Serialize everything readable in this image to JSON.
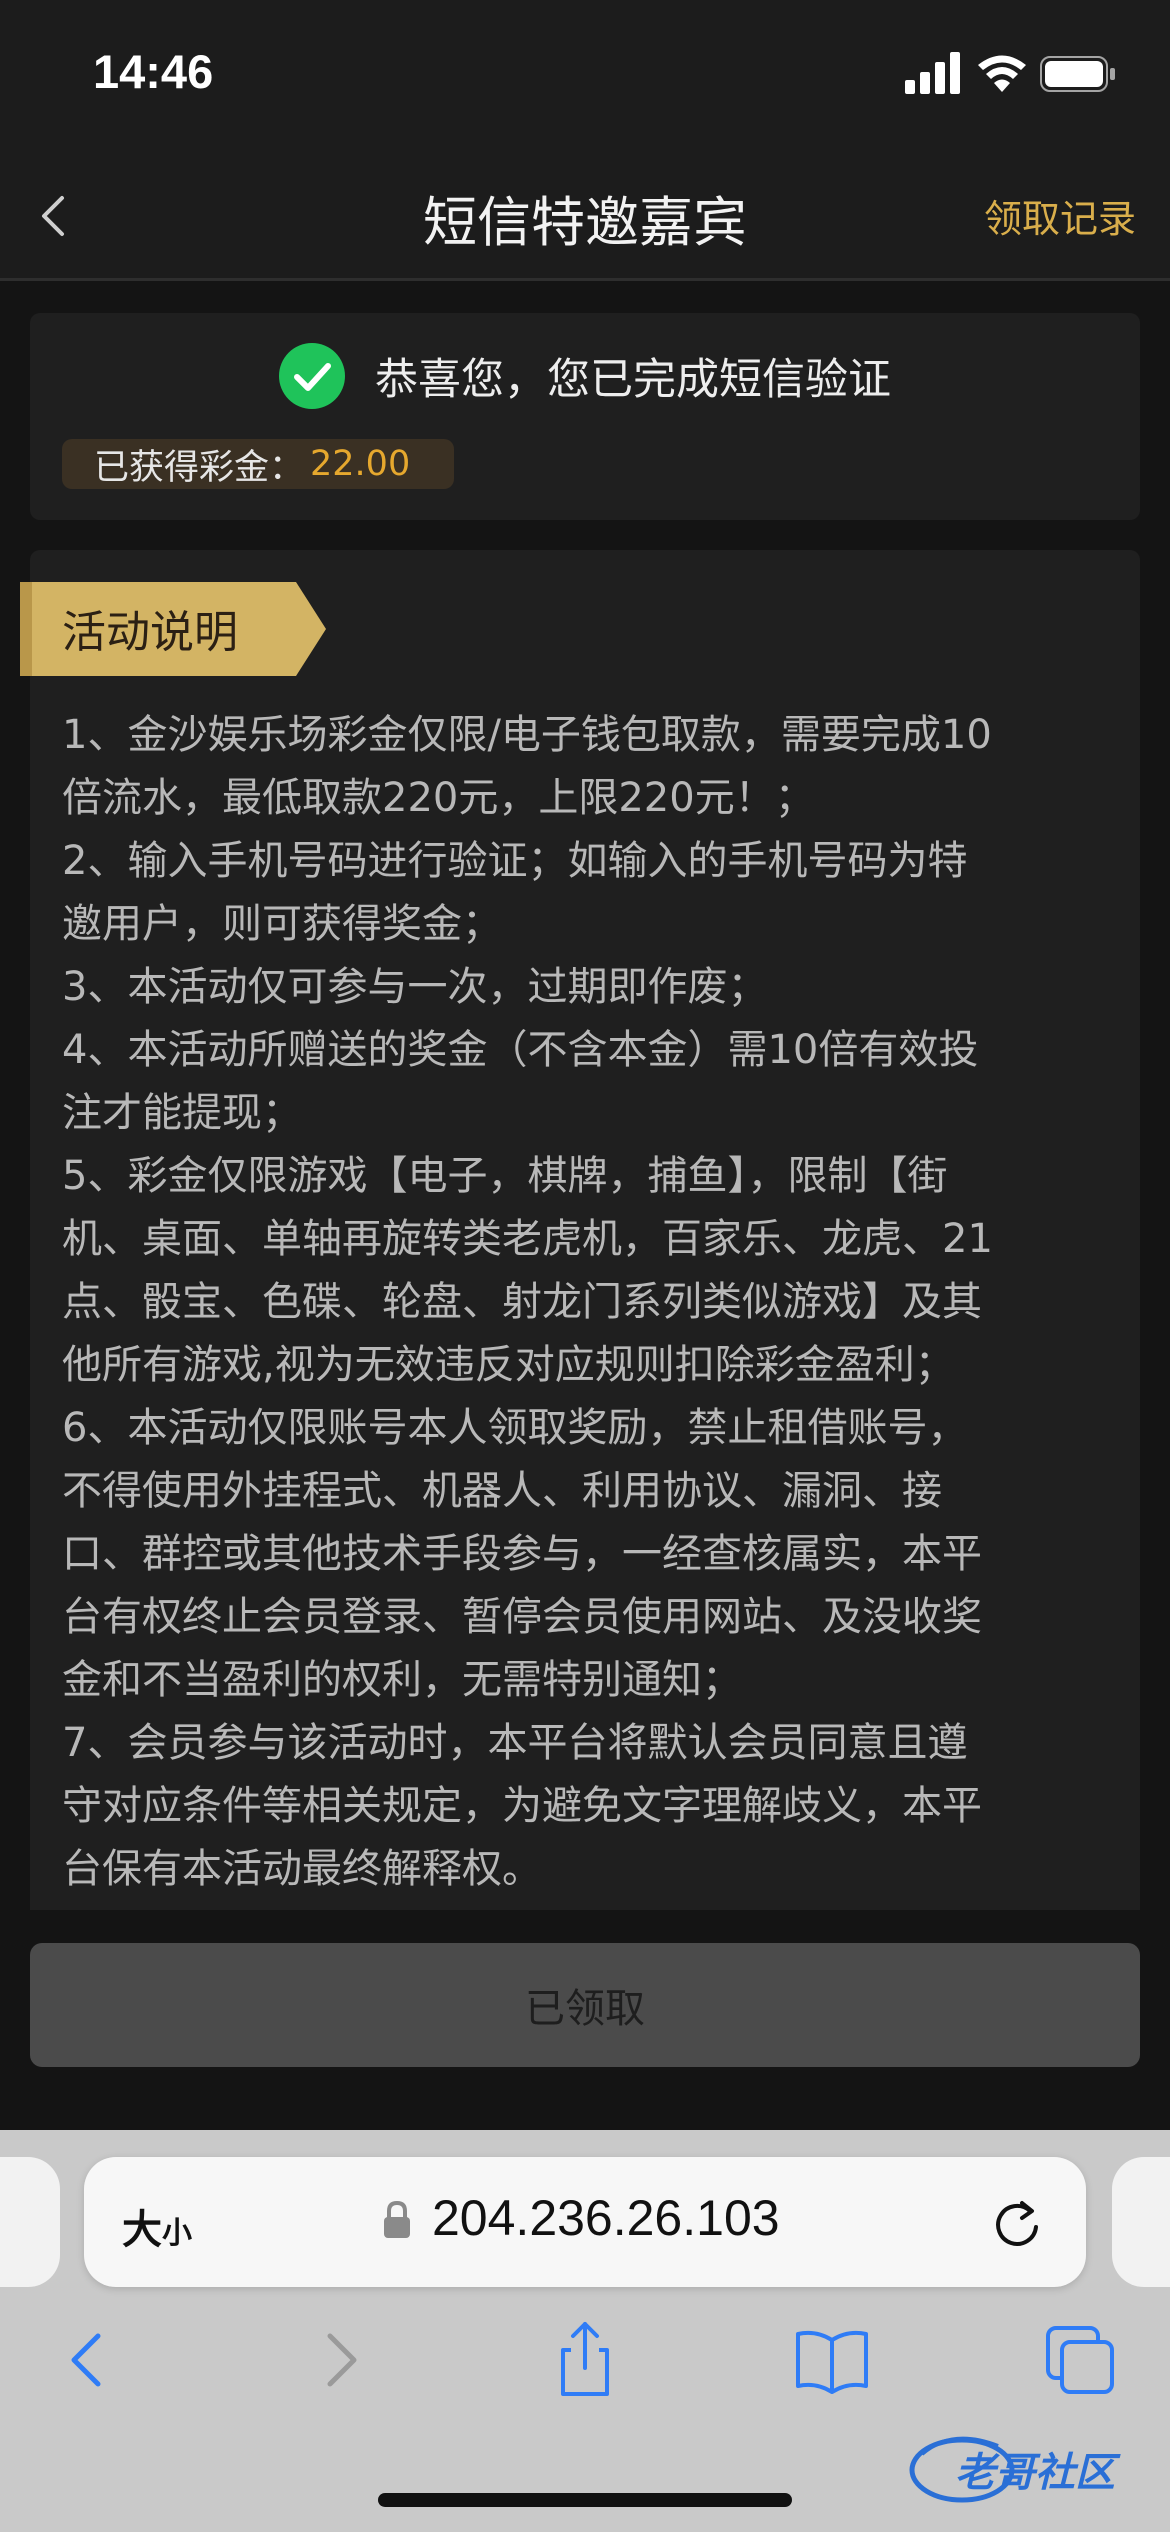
{
  "status_bar": {
    "time": "14:46"
  },
  "nav": {
    "title": "短信特邀嘉宾",
    "records": "领取记录"
  },
  "success": {
    "message": "恭喜您，您已完成短信验证",
    "bonus_label": "已获得彩金：",
    "bonus_value": "22.00"
  },
  "activity": {
    "heading": "活动说明",
    "lines": [
      "1、金沙娱乐场彩金仅限/电子钱包取款，需要完成10",
      "倍流水，最低取款220元，上限220元！；",
      "2、输入手机号码进行验证；如输入的手机号码为特",
      "邀用户，则可获得奖金；",
      "3、本活动仅可参与一次，过期即作废；",
      "4、本活动所赠送的奖金（不含本金）需10倍有效投",
      "注才能提现；",
      "5、彩金仅限游戏【电子，棋牌，捕鱼】，限制【街",
      "机、桌面、单轴再旋转类老虎机，百家乐、龙虎、21",
      "点、骰宝、色碟、轮盘、射龙门系列类似游戏】及其",
      "他所有游戏,视为无效违反对应规则扣除彩金盈利；",
      "6、本活动仅限账号本人领取奖励，禁止租借账号，",
      "不得使用外挂程式、机器人、利用协议、漏洞、接",
      "口、群控或其他技术手段参与，一经查核属实，本平",
      "台有权终止会员登录、暂停会员使用网站、及没收奖",
      "金和不当盈利的权利，无需特别通知；",
      "7、会员参与该活动时，本平台将默认会员同意且遵",
      "守对应条件等相关规定，为避免文字理解歧义，本平",
      "台保有本活动最终解释权。"
    ]
  },
  "action": {
    "button_label": "已领取"
  },
  "browser": {
    "text_size_big": "大",
    "text_size_small": "小",
    "url": "204.236.26.103"
  },
  "watermark": {
    "text": "老哥社区"
  },
  "colors": {
    "accent_gold": "#d9ae4b",
    "bonus_orange": "#e6a82e",
    "success_green": "#1fc35a",
    "safari_blue": "#2f7cf6"
  }
}
